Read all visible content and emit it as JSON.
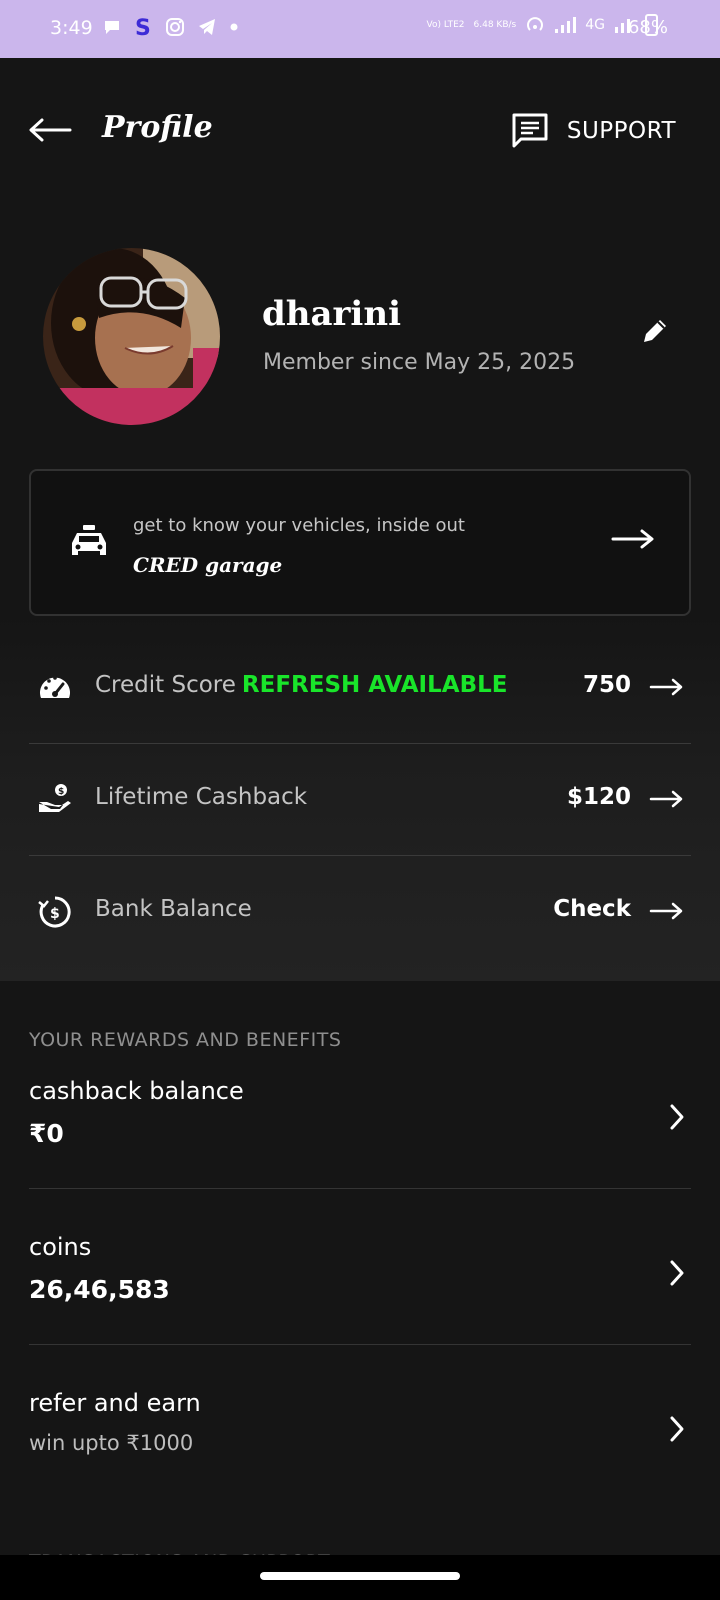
{
  "status_bar": {
    "time": "3:49",
    "volte": "Vo) LTE2",
    "speed": "6.48 KB/s",
    "network": "4G",
    "battery": "68%"
  },
  "header": {
    "title": "Profile",
    "support_label": "SUPPORT"
  },
  "profile": {
    "name": "dharini",
    "member_since": "Member since May 25, 2025"
  },
  "garage": {
    "subtitle": "get to know your vehicles, inside out",
    "title": "CRED garage"
  },
  "stats": [
    {
      "label": "Credit Score",
      "badge": "REFRESH AVAILABLE",
      "value": "750",
      "icon": "speedometer-icon"
    },
    {
      "label": "Lifetime Cashback",
      "badge": "",
      "value": "$120",
      "icon": "cashback-hand-icon"
    },
    {
      "label": "Bank Balance",
      "badge": "",
      "value": "Check",
      "icon": "bank-balance-icon"
    }
  ],
  "rewards": {
    "section_title": "YOUR REWARDS AND BENEFITS",
    "items": [
      {
        "title": "cashback balance",
        "value": "₹0"
      },
      {
        "title": "coins",
        "value": "26,46,583"
      },
      {
        "title": "refer and earn",
        "value": "win upto ₹1000"
      }
    ],
    "next_section_title": "TRANSACTIONS AND SUPPORT"
  },
  "colors": {
    "background": "#151515",
    "status_bar": "#cbb6ec",
    "accent_green": "#19e52a"
  }
}
